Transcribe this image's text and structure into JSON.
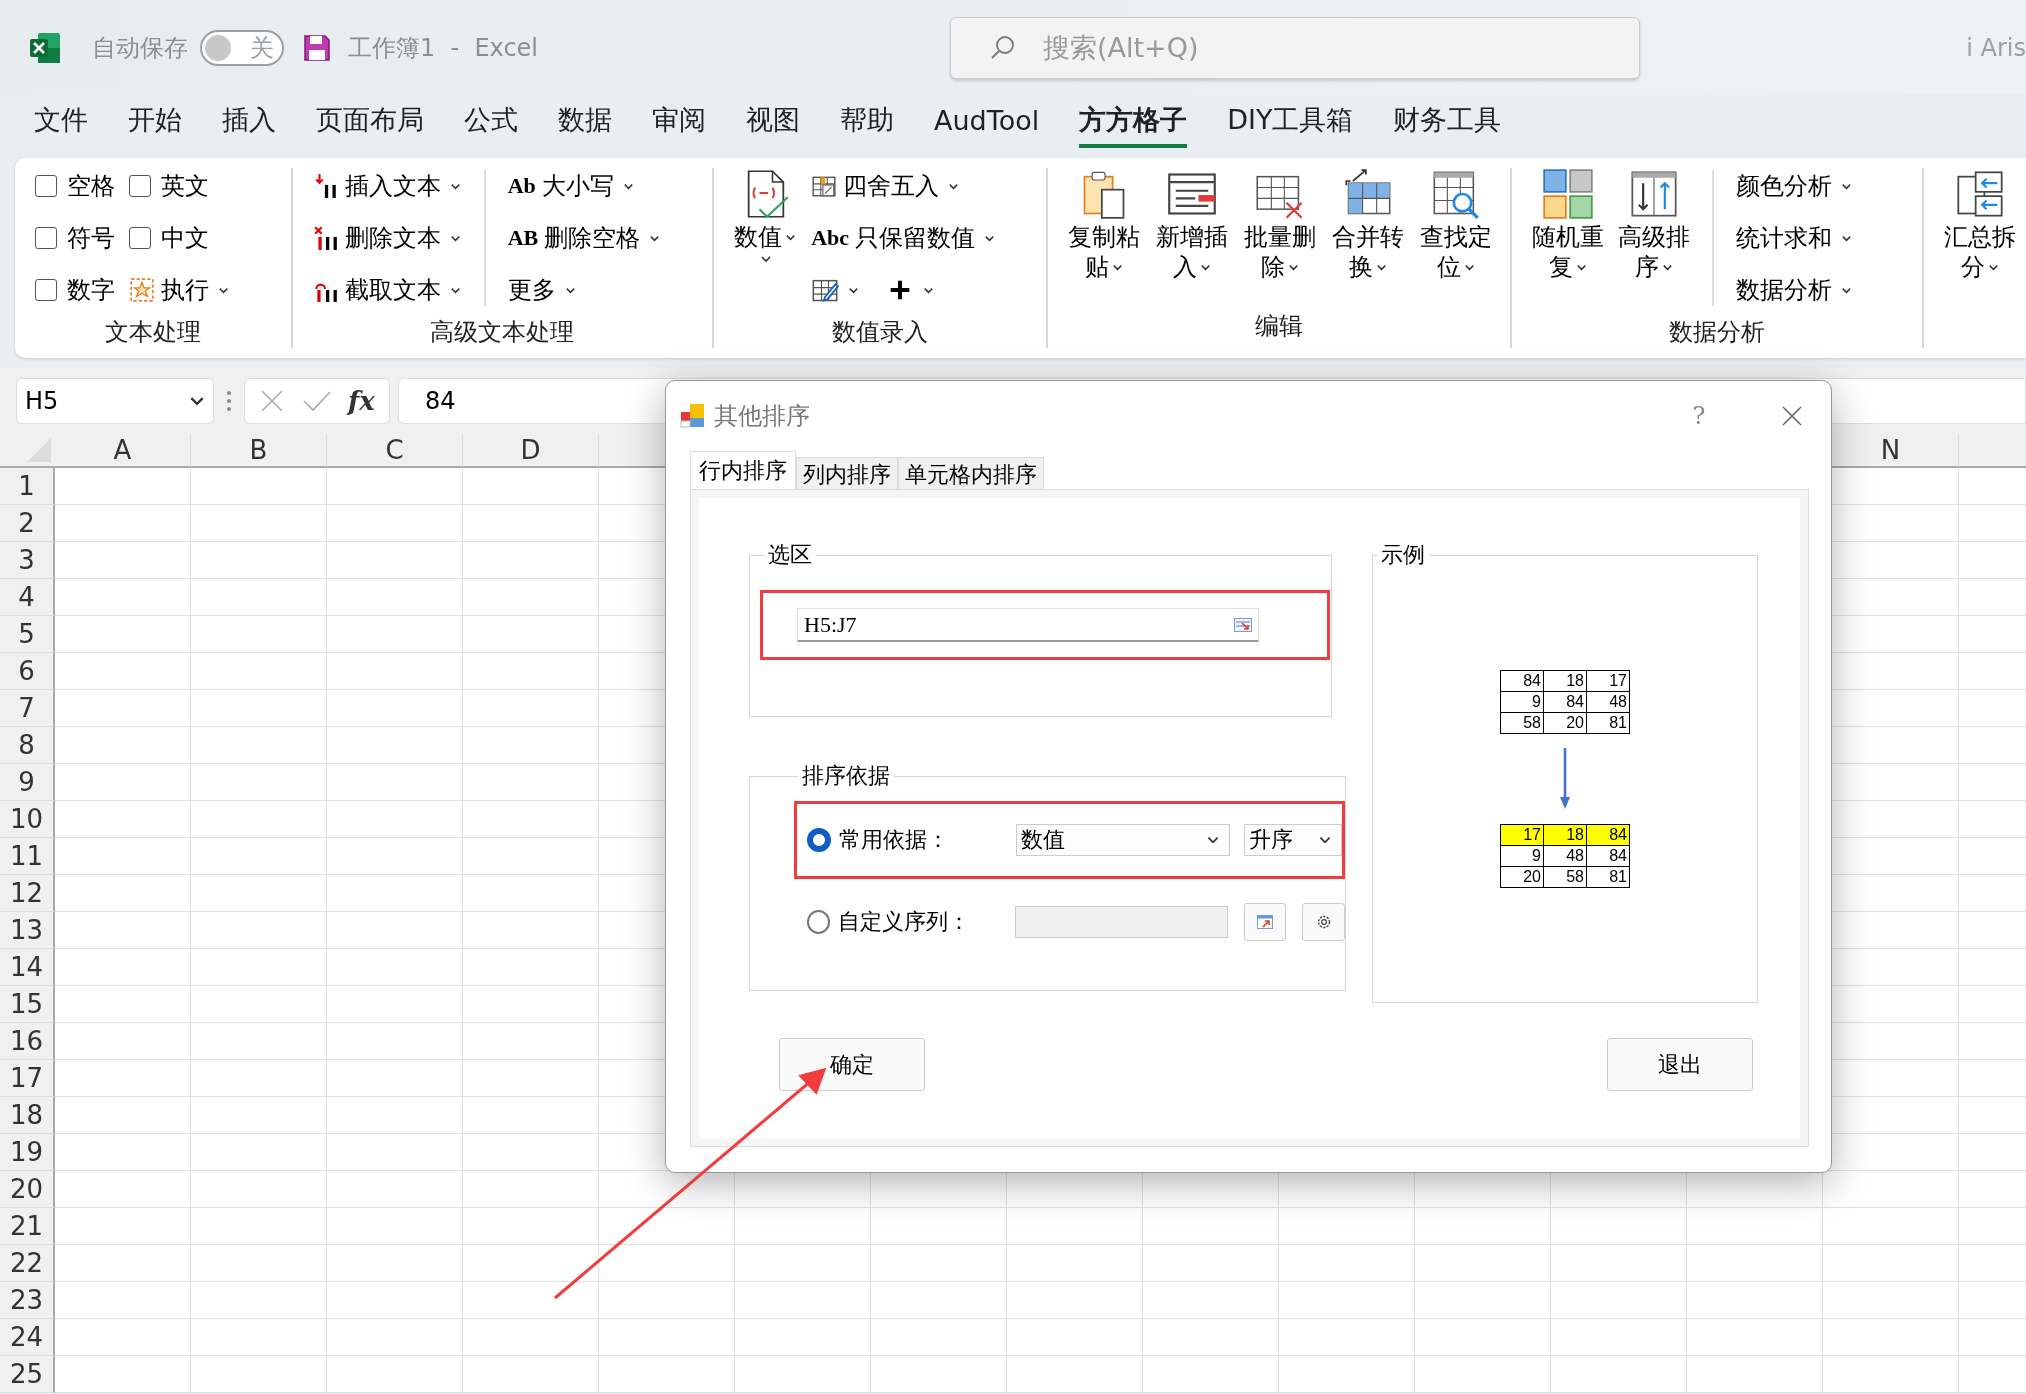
{
  "titlebar": {
    "autosave_label": "自动保存",
    "autosave_toggle": {
      "on": false,
      "label": "关"
    },
    "document_title": "工作簿1  -  Excel",
    "search": {
      "placeholder": "搜索(Alt+Q)"
    },
    "user": "i Aris"
  },
  "menu_tabs": [
    {
      "label": "文件",
      "selected": false
    },
    {
      "label": "开始",
      "selected": false
    },
    {
      "label": "插入",
      "selected": false
    },
    {
      "label": "页面布局",
      "selected": false
    },
    {
      "label": "公式",
      "selected": false
    },
    {
      "label": "数据",
      "selected": false
    },
    {
      "label": "审阅",
      "selected": false
    },
    {
      "label": "视图",
      "selected": false
    },
    {
      "label": "帮助",
      "selected": false
    },
    {
      "label": "AudTool",
      "selected": false
    },
    {
      "label": "方方格子",
      "selected": true
    },
    {
      "label": "DIY工具箱",
      "selected": false
    },
    {
      "label": "财务工具",
      "selected": false
    }
  ],
  "ribbon_groups": [
    {
      "label": "文本处理",
      "columns": [
        {
          "kind": "stack",
          "items": [
            {
              "kind": "checkbox",
              "label": "空格",
              "checked": false
            },
            {
              "kind": "checkbox",
              "label": "符号",
              "checked": false
            },
            {
              "kind": "checkbox",
              "label": "数字",
              "checked": false
            }
          ]
        },
        {
          "kind": "stack",
          "items": [
            {
              "kind": "checkbox",
              "label": "英文",
              "checked": false
            },
            {
              "kind": "checkbox",
              "label": "中文",
              "checked": false
            },
            {
              "kind": "small",
              "label": "执行"
            }
          ]
        }
      ]
    },
    {
      "label": "高级文本处理",
      "columns": [
        {
          "kind": "stack",
          "items": [
            {
              "kind": "small",
              "label": "插入文本"
            },
            {
              "kind": "small",
              "label": "删除文本"
            },
            {
              "kind": "small",
              "label": "截取文本"
            }
          ]
        },
        {
          "kind": "divider"
        },
        {
          "kind": "stack",
          "items": [
            {
              "kind": "small",
              "label": "大小写",
              "icon_text": "Ab"
            },
            {
              "kind": "small",
              "label": "删除空格",
              "icon_text": "AB"
            },
            {
              "kind": "small",
              "label": "更多"
            }
          ]
        }
      ]
    },
    {
      "label": "数值录入",
      "columns": [
        {
          "kind": "stack",
          "items": [
            {
              "kind": "large",
              "lines": [
                "数值"
              ]
            }
          ]
        },
        {
          "kind": "stack",
          "items": [
            {
              "kind": "small",
              "label": "四舍五入"
            },
            {
              "kind": "small",
              "label": "只保留数值",
              "icon_text": "Abc"
            },
            {
              "kind": "row",
              "items": [
                {
                  "kind": "icon_menu"
                },
                {
                  "kind": "icon_menu"
                }
              ]
            }
          ]
        }
      ]
    },
    {
      "label": "编辑",
      "columns": [
        {
          "kind": "stack",
          "items": [
            {
              "kind": "large",
              "lines": [
                "复制粘",
                "贴"
              ]
            }
          ]
        },
        {
          "kind": "stack",
          "items": [
            {
              "kind": "large",
              "lines": [
                "新增插",
                "入"
              ]
            }
          ]
        },
        {
          "kind": "stack",
          "items": [
            {
              "kind": "large",
              "lines": [
                "批量删",
                "除"
              ]
            }
          ]
        },
        {
          "kind": "stack",
          "items": [
            {
              "kind": "large",
              "lines": [
                "合并转",
                "换"
              ]
            }
          ]
        },
        {
          "kind": "stack",
          "items": [
            {
              "kind": "large",
              "lines": [
                "查找定",
                "位"
              ]
            }
          ]
        }
      ]
    },
    {
      "label": "数据分析",
      "columns": [
        {
          "kind": "stack",
          "items": [
            {
              "kind": "large",
              "lines": [
                "随机重",
                "复"
              ]
            }
          ]
        },
        {
          "kind": "stack",
          "items": [
            {
              "kind": "large",
              "lines": [
                "高级排",
                "序"
              ]
            }
          ]
        },
        {
          "kind": "divider"
        },
        {
          "kind": "stack",
          "items": [
            {
              "kind": "small",
              "label": "颜色分析"
            },
            {
              "kind": "small",
              "label": "统计求和"
            },
            {
              "kind": "small",
              "label": "数据分析"
            }
          ]
        }
      ]
    },
    {
      "columns": [
        {
          "kind": "stack",
          "items": [
            {
              "kind": "large",
              "lines": [
                "汇总拆",
                "分"
              ]
            }
          ]
        }
      ]
    }
  ],
  "formula_bar": {
    "name_box": "H5",
    "function_label": "fx",
    "value": "84"
  },
  "sheet": {
    "column_headers": [
      "A",
      "B",
      "C",
      "D",
      "N"
    ],
    "row_headers": [
      "1",
      "2",
      "3",
      "4",
      "5",
      "6",
      "7",
      "8",
      "9",
      "10",
      "11",
      "12",
      "13",
      "14",
      "15",
      "16",
      "17",
      "18",
      "19",
      "20",
      "21",
      "22",
      "23",
      "24",
      "25"
    ]
  },
  "dialog": {
    "title": "其他排序",
    "help": "?",
    "tabs": [
      {
        "label": "行内排序",
        "selected": true
      },
      {
        "label": "列内排序",
        "selected": false
      },
      {
        "label": "单元格内排序",
        "selected": false
      }
    ],
    "selection_group": {
      "title": "选区",
      "outlined": true,
      "range_field": {
        "value": "H5:J7"
      }
    },
    "sort_group": {
      "title": "排序依据",
      "options": [
        {
          "kind": "dropdowns",
          "label": "常用依据：",
          "selected": true,
          "outlined": true,
          "fields": [
            "数值",
            "升序"
          ]
        },
        {
          "kind": "list_picker",
          "label": "自定义序列：",
          "selected": false,
          "outlined": false
        }
      ]
    },
    "example_group": {
      "title": "示例",
      "before": [
        {
          "highlighted": false,
          "cells": [
            "84",
            "18",
            "17"
          ]
        },
        {
          "highlighted": false,
          "cells": [
            "9",
            "84",
            "48"
          ]
        },
        {
          "highlighted": false,
          "cells": [
            "58",
            "20",
            "81"
          ]
        }
      ],
      "after": [
        {
          "highlighted": true,
          "cells": [
            "17",
            "18",
            "84"
          ]
        },
        {
          "highlighted": false,
          "cells": [
            "9",
            "48",
            "84"
          ]
        },
        {
          "highlighted": false,
          "cells": [
            "20",
            "58",
            "81"
          ]
        }
      ]
    },
    "buttons": [
      {
        "label": "确定"
      },
      {
        "label": "退出"
      }
    ]
  }
}
